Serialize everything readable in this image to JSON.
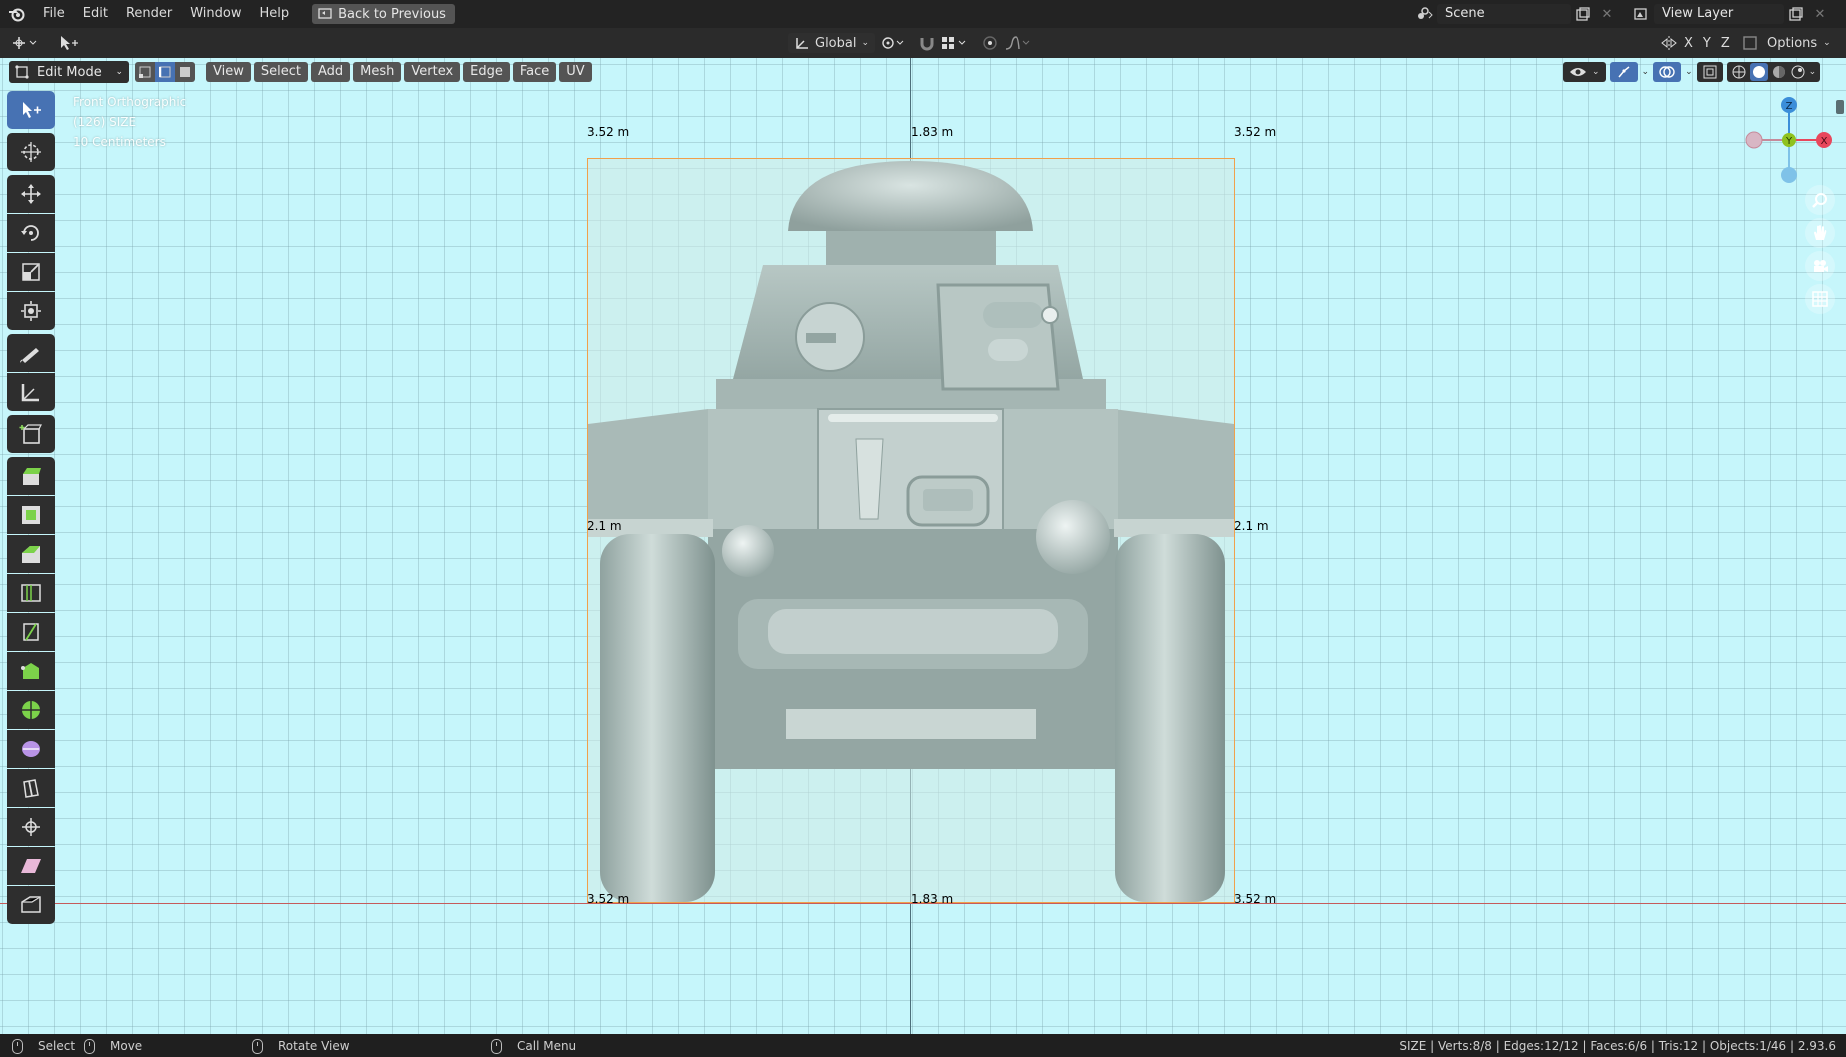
{
  "app": {
    "menu": [
      "File",
      "Edit",
      "Render",
      "Window",
      "Help"
    ],
    "back_button": "Back to Previous",
    "scene": "Scene",
    "view_layer": "View Layer"
  },
  "header2": {
    "transform_orientation": "Global",
    "axes": [
      "X",
      "Y",
      "Z"
    ],
    "options": "Options"
  },
  "viewport_header": {
    "mode": "Edit Mode",
    "menus": [
      "View",
      "Select",
      "Add",
      "Mesh",
      "Vertex",
      "Edge",
      "Face",
      "UV"
    ]
  },
  "viewport": {
    "view_name": "Front Orthographic",
    "object_info": "(126) SIZE",
    "scale": "10 Centimeters",
    "measurements": {
      "top_left": "3.52 m",
      "top_center": "1.83 m",
      "top_right": "3.52 m",
      "mid_left": "2.1 m",
      "mid_right": "2.1 m",
      "bottom_left": "3.52 m",
      "bottom_center": "1.83 m",
      "bottom_right": "3.52 m"
    },
    "gizmo": {
      "z": "Z",
      "y": "Y",
      "x": "X"
    }
  },
  "toolbar": {
    "tools": [
      "select-box",
      "cursor",
      "move",
      "rotate",
      "scale",
      "transform",
      "annotate",
      "measure",
      "add-cube",
      "extrude",
      "inset",
      "bevel",
      "loop-cut",
      "knife",
      "poly-build",
      "spin",
      "smooth",
      "edge-slide",
      "shrink-fatten",
      "shear",
      "rip"
    ]
  },
  "colors": {
    "accent": "#4772b3",
    "viewport_bg": "#c6f6fb",
    "selection": "#f0a04b",
    "axis_x": "#e8475c",
    "axis_y": "#8fc21f",
    "axis_z": "#3b8ed9"
  },
  "status": {
    "select": "Select",
    "move": "Move",
    "rotate": "Rotate View",
    "call_menu": "Call Menu",
    "stats": "SIZE | Verts:8/8 | Edges:12/12 | Faces:6/6 | Tris:12 | Objects:1/46 | 2.93.6"
  }
}
